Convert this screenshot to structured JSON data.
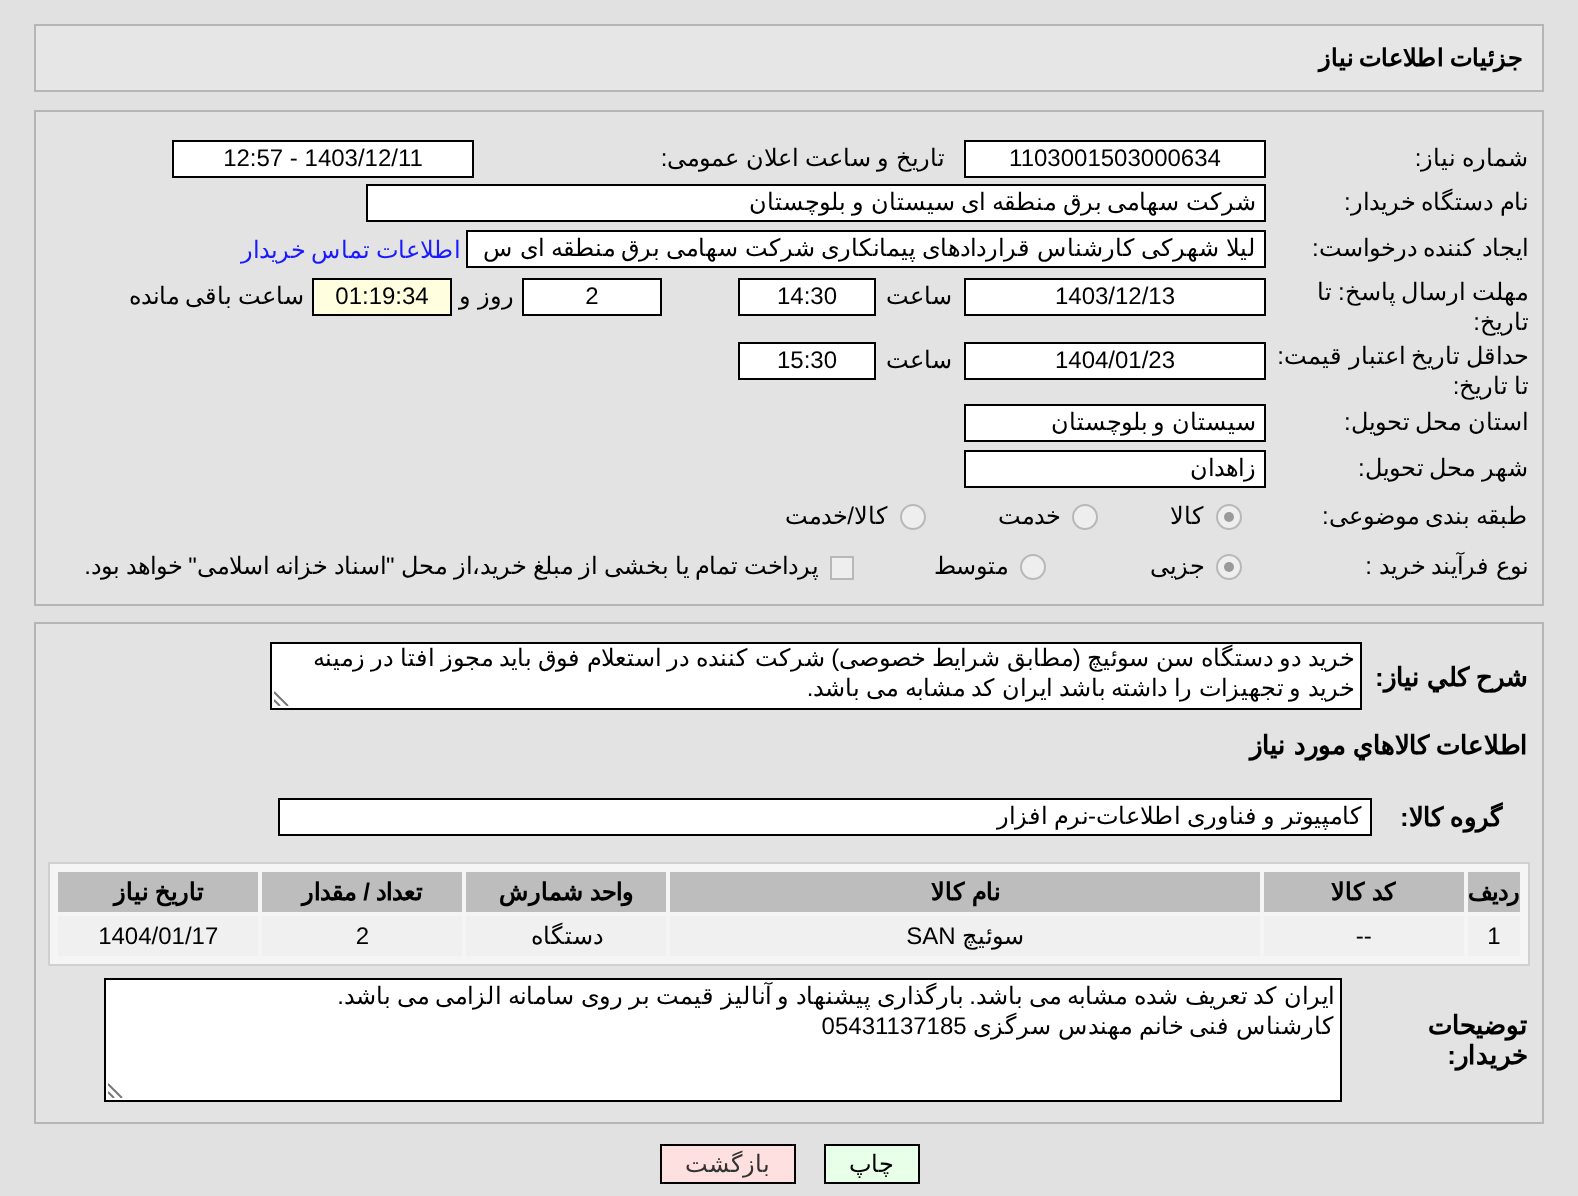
{
  "header": {
    "title": "جزئیات اطلاعات نیاز"
  },
  "need_number": {
    "label": "شماره نیاز:",
    "value": "1103001503000634"
  },
  "announce": {
    "label": "تاریخ و ساعت اعلان عمومی:",
    "value": "1403/12/11 - 12:57"
  },
  "buyer_org": {
    "label": "نام دستگاه خریدار:",
    "value": "شرکت سهامی برق منطقه ای سیستان و بلوچستان"
  },
  "requester": {
    "label": "ایجاد کننده درخواست:",
    "value": "لیلا شهرکی کارشناس قراردادهای پیمانکاری شرکت سهامی برق منطقه ای س",
    "link": "اطلاعات تماس خریدار"
  },
  "deadline": {
    "label": "مهلت ارسال پاسخ: تا تاریخ:",
    "date": "1403/12/13",
    "time_label": "ساعت",
    "time": "14:30",
    "days": "2",
    "days_label": "روز و",
    "remaining": "01:19:34",
    "remaining_label": "ساعت باقی مانده"
  },
  "validity": {
    "label": "حداقل تاریخ اعتبار قیمت: تا تاریخ:",
    "date": "1404/01/23",
    "time_label": "ساعت",
    "time": "15:30"
  },
  "province": {
    "label": "استان محل تحویل:",
    "value": "سیستان و بلوچستان"
  },
  "city": {
    "label": "شهر محل تحویل:",
    "value": "زاهدان"
  },
  "category": {
    "label": "طبقه بندی موضوعی:",
    "options": [
      {
        "label": "کالا",
        "selected": true
      },
      {
        "label": "خدمت",
        "selected": false
      },
      {
        "label": "کالا/خدمت",
        "selected": false
      }
    ]
  },
  "process": {
    "label": "نوع فرآیند خرید :",
    "options": [
      {
        "label": "جزیی",
        "selected": true
      },
      {
        "label": "متوسط",
        "selected": false
      }
    ],
    "payment": {
      "checked": false,
      "text": "پرداخت تمام یا بخشی از مبلغ خرید،از محل \"اسناد خزانه اسلامی\" خواهد بود."
    }
  },
  "description": {
    "label": "شرح کلي نياز:",
    "value": "خرید دو دستگاه سن سوئیچ (مطابق شرایط خصوصی) شرکت کننده در استعلام فوق باید مجوز افتا در زمینه خرید و تجهیزات را داشته باشد ایران کد مشابه می باشد."
  },
  "goods_heading": "اطلاعات کالاهاي مورد نياز",
  "goods_group": {
    "label": "گروه کالا:",
    "value": "کامپیوتر و فناوری اطلاعات-نرم افزار"
  },
  "table": {
    "columns": [
      "ردیف",
      "کد کالا",
      "نام کالا",
      "واحد شمارش",
      "تعداد / مقدار",
      "تاریخ نیاز"
    ],
    "rows": [
      [
        "1",
        "--",
        "سوئیچ SAN",
        "دستگاه",
        "2",
        "1404/01/17"
      ]
    ]
  },
  "buyer_notes": {
    "label": "توضیحات خریدار:",
    "lines": [
      "ایران کد تعریف شده مشابه می باشد. بارگذاری پیشنهاد و آنالیز قیمت بر روی سامانه الزامی می باشد.",
      "کارشناس فنی خانم مهندس سرگزی 05431137185"
    ]
  },
  "buttons": [
    {
      "label": "چاپ",
      "kind": "print"
    },
    {
      "label": "بازگشت",
      "kind": "back"
    }
  ]
}
